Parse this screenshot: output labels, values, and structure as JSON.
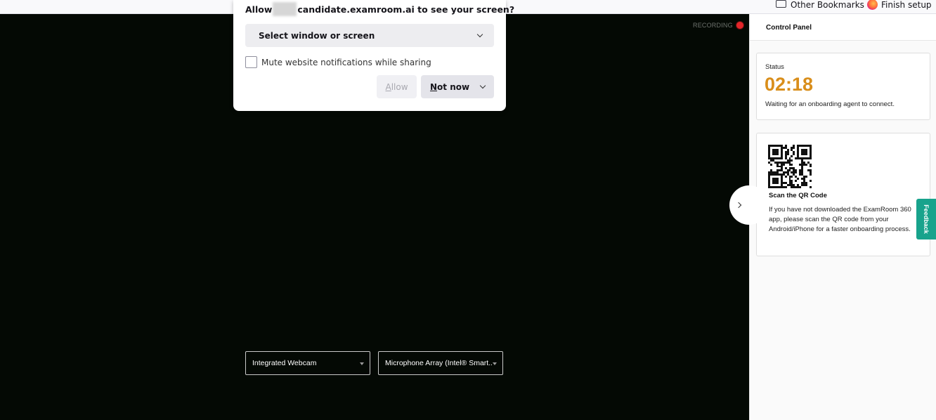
{
  "bookmarks": {
    "other_bookmarks": "Other Bookmarks",
    "finish_setup": "Finish setup"
  },
  "permission": {
    "title_prefix": "Allow",
    "title_suffix": "candidate.examroom.ai to see your screen?",
    "select_label": "Select window or screen",
    "mute_label": "Mute website notifications while sharing",
    "mute_checked": false,
    "allow_label": "Allow",
    "not_now_label": "Not now"
  },
  "stage": {
    "recording_label": "RECORDING",
    "camera_selected": "Integrated Webcam",
    "mic_selected": "Microphone Array (Intel® Smart..."
  },
  "panel": {
    "title": "Control Panel",
    "status_label": "Status",
    "timer": "02:18",
    "status_message": "Waiting for an onboarding agent to connect.",
    "qr_title": "Scan the QR Code",
    "qr_description": "If you have not downloaded the ExamRoom 360 app, please scan the QR code from your Android/iPhone for a faster onboarding process."
  },
  "feedback_label": "Feedback",
  "colors": {
    "stage_bg": "#040904",
    "timer": "#d98e1b",
    "recording_dot": "#e3262a",
    "feedback_tab": "#18a38c"
  },
  "icons": [
    "folder-icon",
    "firefox-icon",
    "recording-dot-icon",
    "chevron-down-icon",
    "chevron-right-icon",
    "caret-down-icon",
    "qr-code"
  ]
}
